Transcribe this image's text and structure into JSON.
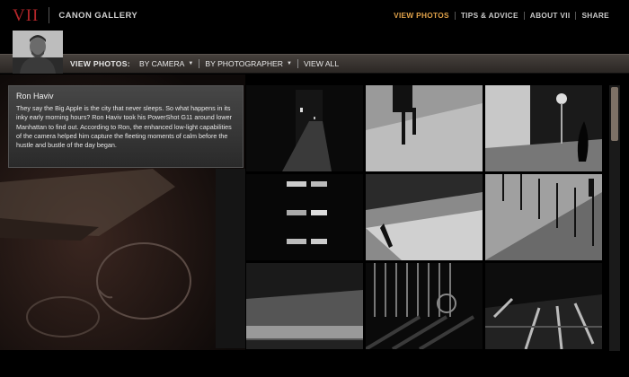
{
  "brand": {
    "logo": "VII",
    "name": "CANON GALLERY"
  },
  "top_nav": [
    {
      "label": "VIEW PHOTOS",
      "active": true
    },
    {
      "label": "TIPS & ADVICE",
      "active": false
    },
    {
      "label": "ABOUT VII",
      "active": false
    },
    {
      "label": "SHARE",
      "active": false
    }
  ],
  "sub_nav": {
    "label": "VIEW PHOTOS:",
    "by_camera": "BY CAMERA",
    "by_photographer": "BY PHOTOGRAPHER",
    "view_all": "VIEW ALL"
  },
  "info": {
    "title": "Ron Haviv",
    "text": "They say the Big Apple is the city that never sleeps.  So what happens in its inky early morning hours? Ron Haviv took his PowerShot G11 around lower Manhattan to find out. According to Ron, the enhanced low-light capabilities of the camera helped him capture the fleeting moments of calm before the hustle and bustle of the day began."
  },
  "colors": {
    "accent": "#e0a24a",
    "logo": "#b3262a",
    "scroll_thumb": "#7d7166"
  },
  "thumbnails": [
    {
      "subject": "night cobblestone alley"
    },
    {
      "subject": "pedestrian legs on sidewalk"
    },
    {
      "subject": "street corner with stop sign and figure"
    },
    {
      "subject": "lit windows at night"
    },
    {
      "subject": "diagonal sidewalk with person"
    },
    {
      "subject": "stairs with railing"
    },
    {
      "subject": "subway stairs"
    },
    {
      "subject": "fence shadows"
    },
    {
      "subject": "street crosswalk lines"
    }
  ]
}
